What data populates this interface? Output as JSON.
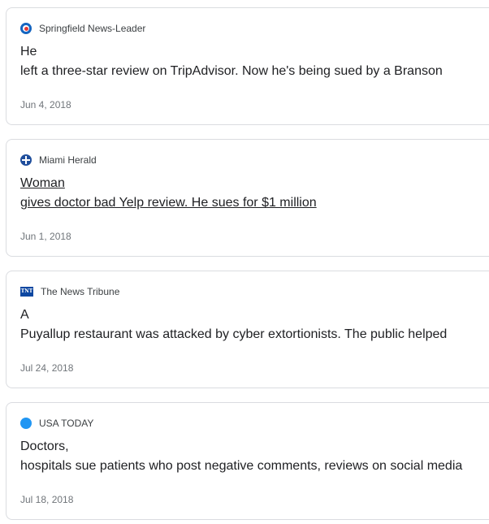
{
  "articles": [
    {
      "source": "Springfield News-Leader",
      "icon": "springfield-news-leader-logo-icon",
      "headline_line1": "He",
      "headline_line2": "left a three-star review on TripAdvisor. Now he's being sued by a Branson",
      "date": "Jun 4, 2018"
    },
    {
      "source": "Miami Herald",
      "icon": "miami-herald-logo-icon",
      "headline_line1": "Woman",
      "headline_line2": "gives doctor bad Yelp review. He sues for $1 million",
      "date": "Jun 1, 2018"
    },
    {
      "source": "The News Tribune",
      "icon": "news-tribune-logo-icon",
      "icon_text": "TNT",
      "headline_line1": "A",
      "headline_line2": "Puyallup restaurant was attacked by cyber extortionists. The public helped",
      "date": "Jul 24, 2018"
    },
    {
      "source": "USA TODAY",
      "icon": "usa-today-logo-icon",
      "headline_line1": "Doctors,",
      "headline_line2": "hospitals sue patients who post negative comments, reviews on social media",
      "date": "Jul 18, 2018"
    }
  ],
  "colors": {
    "border": "#dadce0",
    "date_text": "#70757a",
    "usa_today_blue": "#2196f3"
  }
}
